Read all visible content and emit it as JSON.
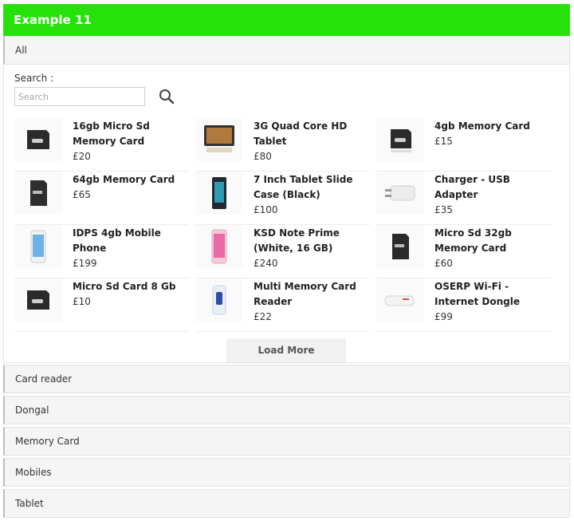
{
  "header": {
    "title": "Example 11"
  },
  "open_section": {
    "label": "All"
  },
  "search": {
    "label": "Search :",
    "placeholder": "Search",
    "value": "",
    "icon": "search-icon"
  },
  "products": [
    {
      "name": "16gb Micro Sd Memory Card",
      "price": "£20",
      "icon": "memory-card-icon"
    },
    {
      "name": "3G Quad Core HD Tablet",
      "price": "£80",
      "icon": "tablet-icon"
    },
    {
      "name": "4gb Memory Card",
      "price": "£15",
      "icon": "memory-card-icon"
    },
    {
      "name": "64gb Memory Card",
      "price": "£65",
      "icon": "memory-card-icon"
    },
    {
      "name": "7 Inch Tablet Slide Case (Black)",
      "price": "£100",
      "icon": "tablet-case-icon"
    },
    {
      "name": "Charger - USB Adapter",
      "price": "£35",
      "icon": "usb-charger-icon"
    },
    {
      "name": "IDPS 4gb Mobile Phone",
      "price": "£199",
      "icon": "phone-white-icon"
    },
    {
      "name": "KSD Note Prime (White, 16 GB)",
      "price": "£240",
      "icon": "phone-pink-icon"
    },
    {
      "name": "Micro Sd 32gb Memory Card",
      "price": "£60",
      "icon": "memory-card-icon"
    },
    {
      "name": "Micro Sd Card 8 Gb",
      "price": "£10",
      "icon": "memory-card-icon"
    },
    {
      "name": "Multi Memory Card Reader",
      "price": "£22",
      "icon": "card-reader-icon"
    },
    {
      "name": "OSERP Wi-Fi - Internet Dongle",
      "price": "£99",
      "icon": "dongle-icon"
    }
  ],
  "load_more_label": "Load More",
  "categories": [
    {
      "label": "Card reader"
    },
    {
      "label": "Dongal"
    },
    {
      "label": "Memory Card"
    },
    {
      "label": "Mobiles"
    },
    {
      "label": "Tablet"
    }
  ],
  "colors": {
    "header_bg": "#27e10b",
    "header_text": "#ffffff"
  }
}
